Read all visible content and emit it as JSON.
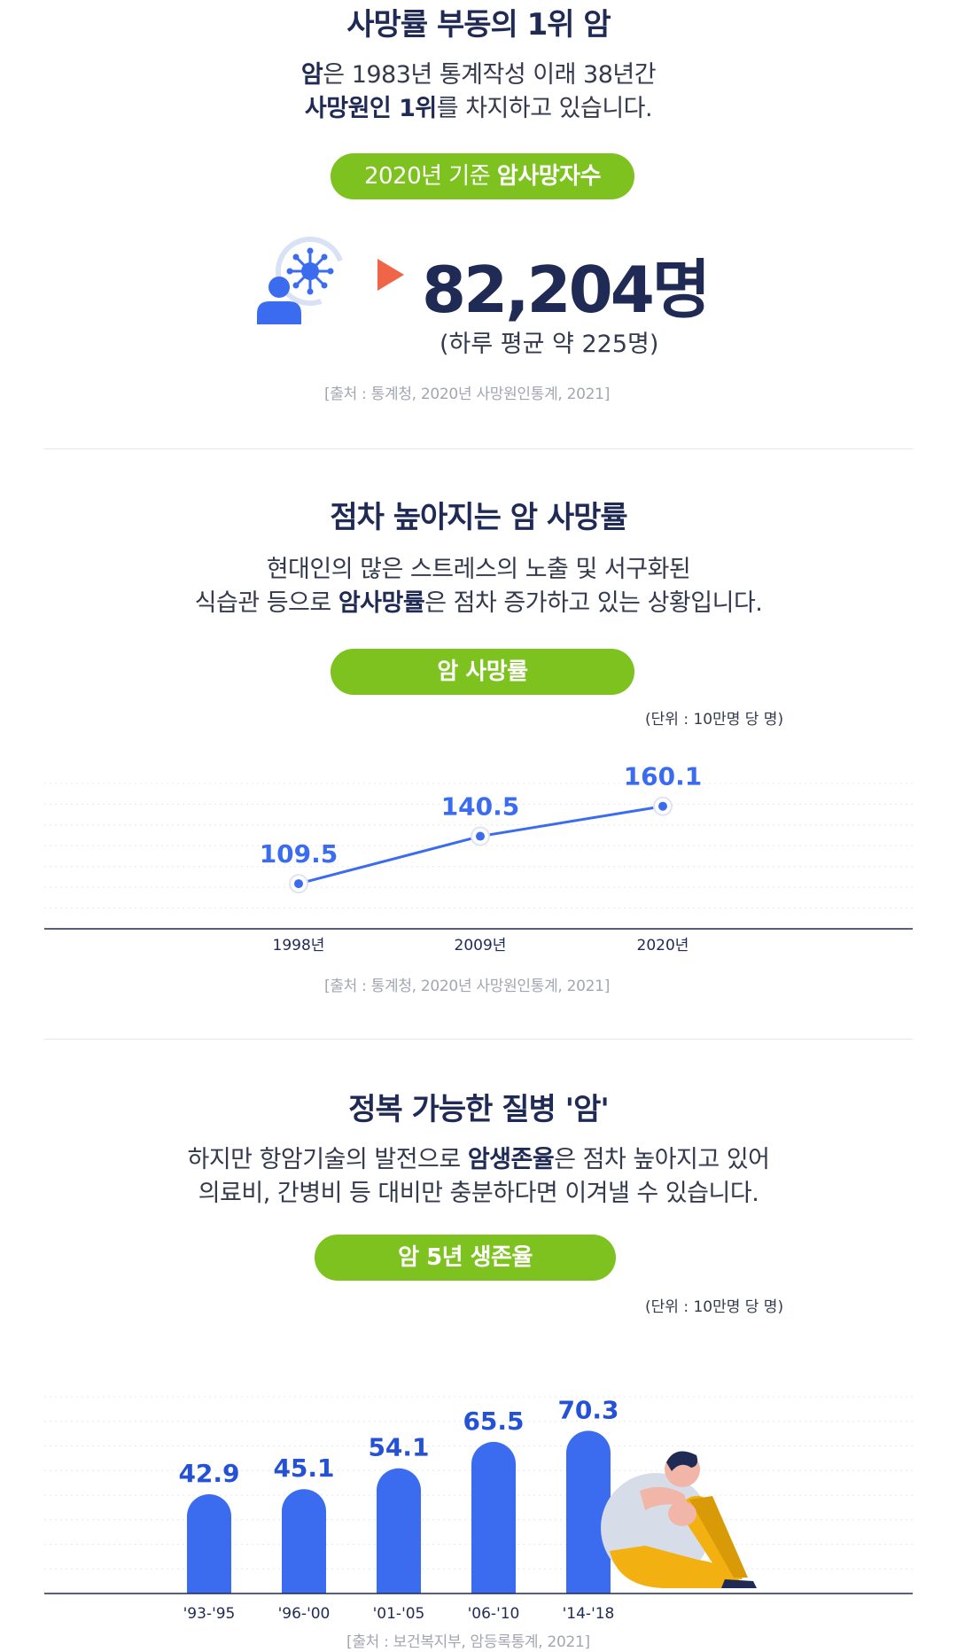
{
  "section1": {
    "title": "사망률 부동의 1위 암",
    "desc_line1_bold": "암",
    "desc_line1_rest": "은 1983년 통계작성 이래 38년간",
    "desc_line2_bold": "사망원인 1위",
    "desc_line2_rest": "를 차지하고 있습니다.",
    "pill_light": "2020년 기준 ",
    "pill_bold": "암사망자수",
    "big_number": "82,204명",
    "sub_number": "(하루 평균 약 225명)",
    "source": "[출처 : 통계청, 2020년 사망원인통계, 2021]",
    "icon": "person-virus-icon",
    "arrow_color": "#f06548"
  },
  "section2": {
    "title": "점차 높아지는 암 사망률",
    "desc_line1": "현대인의 많은 스트레스의 노출 및 서구화된",
    "desc_line2_pre": "식습관 등으로 ",
    "desc_line2_bold": "암사망률",
    "desc_line2_rest": "은 점차 증가하고 있는 상황입니다.",
    "pill": "암 사망률",
    "unit": "(단위 : 10만명 당 명)",
    "source": "[출처 : 통계청, 2020년 사망원인통계, 2021]"
  },
  "section3": {
    "title": "정복 가능한 질병 '암'",
    "desc_line1_pre": "하지만 항암기술의 발전으로 ",
    "desc_line1_bold": "암생존율",
    "desc_line1_rest": "은 점차 높아지고 있어",
    "desc_line2": "의료비, 간병비 등 대비만 충분하다면 이겨낼 수 있습니다.",
    "pill": "암 5년 생존율",
    "unit": "(단위 : 10만명 당 명)",
    "source": "[출처 : 보건복지부, 암등록통계, 2021]",
    "illustration": "sitting-person-illustration"
  },
  "colors": {
    "accent_green": "#7dc21e",
    "chart_blue": "#3b6cf0",
    "navy": "#1f2a55"
  },
  "chart_data": [
    {
      "type": "line",
      "categories": [
        "1998년",
        "2009년",
        "2020년"
      ],
      "values": [
        109.5,
        140.5,
        160.1
      ],
      "data_labels": [
        "109.5",
        "140.5",
        "160.1"
      ],
      "ylim": [
        80,
        175
      ],
      "grid": true
    },
    {
      "type": "bar",
      "categories": [
        "'93-'95",
        "'96-'00",
        "'01-'05",
        "'06-'10",
        "'14-'18"
      ],
      "values": [
        42.9,
        45.1,
        54.1,
        65.5,
        70.3
      ],
      "data_labels": [
        "42.9",
        "45.1",
        "54.1",
        "65.5",
        "70.3"
      ],
      "ylim": [
        0,
        85
      ],
      "grid": true
    }
  ]
}
